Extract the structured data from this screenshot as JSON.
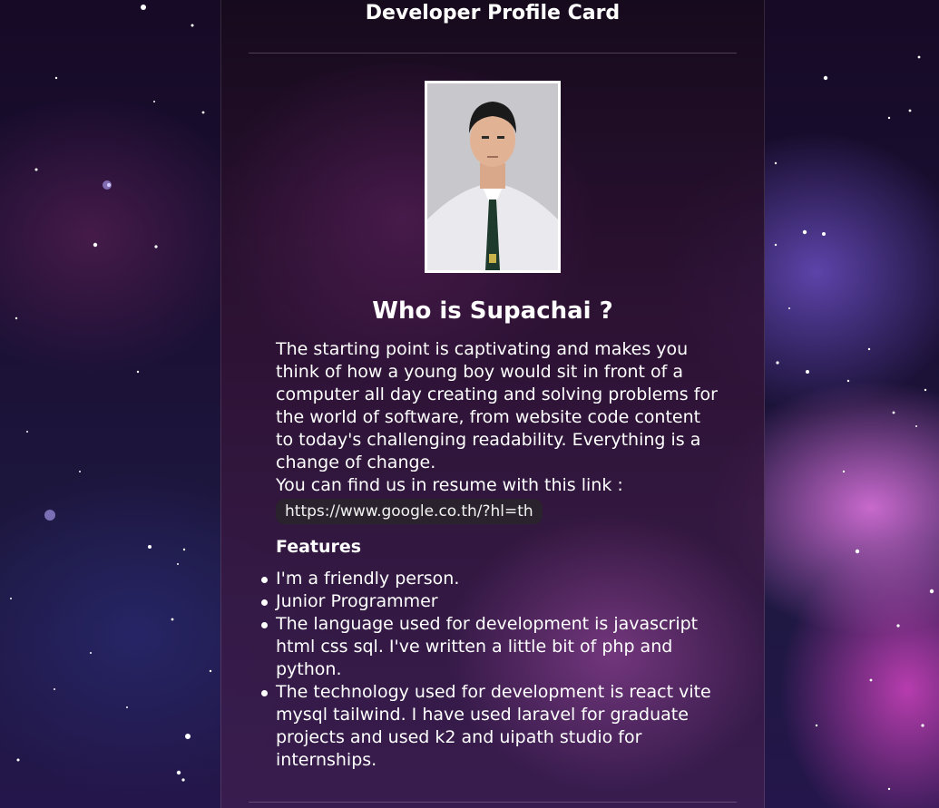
{
  "card": {
    "title": "Developer Profile Card",
    "photo_alt": "profile photo",
    "heading": "Who is Supachai ?",
    "description": "The starting point is captivating and makes you think of how a young boy would sit in front of a computer all day creating and solving problems for the world of software, from website code content to today's challenging readability. Everything is a change of change.",
    "resume_text": "You can find us in resume with this link :",
    "resume_link": "https://www.google.co.th/?hl=th",
    "features_title": "Features",
    "features": [
      "I'm a friendly person.",
      "Junior Programmer",
      "The language used for development is javascript html css sql. I've written a little bit of php and python.",
      "The technology used for development is react vite mysql tailwind. I have used laravel for graduate projects and used k2 and uipath studio for internships."
    ]
  },
  "colors": {
    "text": "#ffffff",
    "link_pill_bg": "#2a2a2a",
    "background_space": "#1b1035",
    "nebula_pink": "#e078e6"
  }
}
